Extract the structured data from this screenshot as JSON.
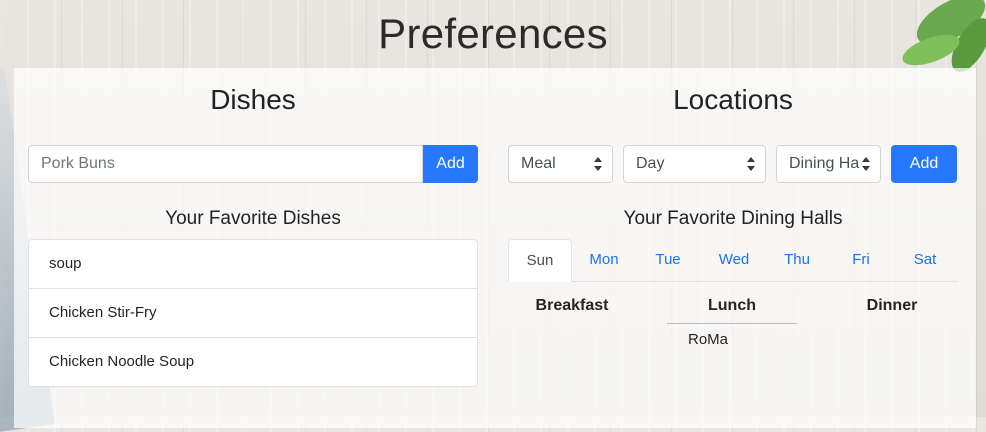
{
  "page": {
    "title": "Preferences"
  },
  "dishes": {
    "title": "Dishes",
    "input_value": "Pork Buns",
    "add_label": "Add",
    "favorites_title": "Your Favorite Dishes",
    "favorites": [
      "soup",
      "Chicken Stir-Fry",
      "Chicken Noodle Soup"
    ]
  },
  "locations": {
    "title": "Locations",
    "selects": {
      "meal": "Meal",
      "day": "Day",
      "hall": "Dining Ha"
    },
    "add_label": "Add",
    "favorites_title": "Your Favorite Dining Halls",
    "tabs": [
      "Sun",
      "Mon",
      "Tue",
      "Wed",
      "Thu",
      "Fri",
      "Sat"
    ],
    "active_tab": "Sun",
    "meals": {
      "breakfast": "Breakfast",
      "lunch": "Lunch",
      "dinner": "Dinner"
    },
    "lunch_halls": [
      "RoMa"
    ]
  },
  "colors": {
    "accent": "#2679ff",
    "tab_link": "#1a73e8"
  }
}
